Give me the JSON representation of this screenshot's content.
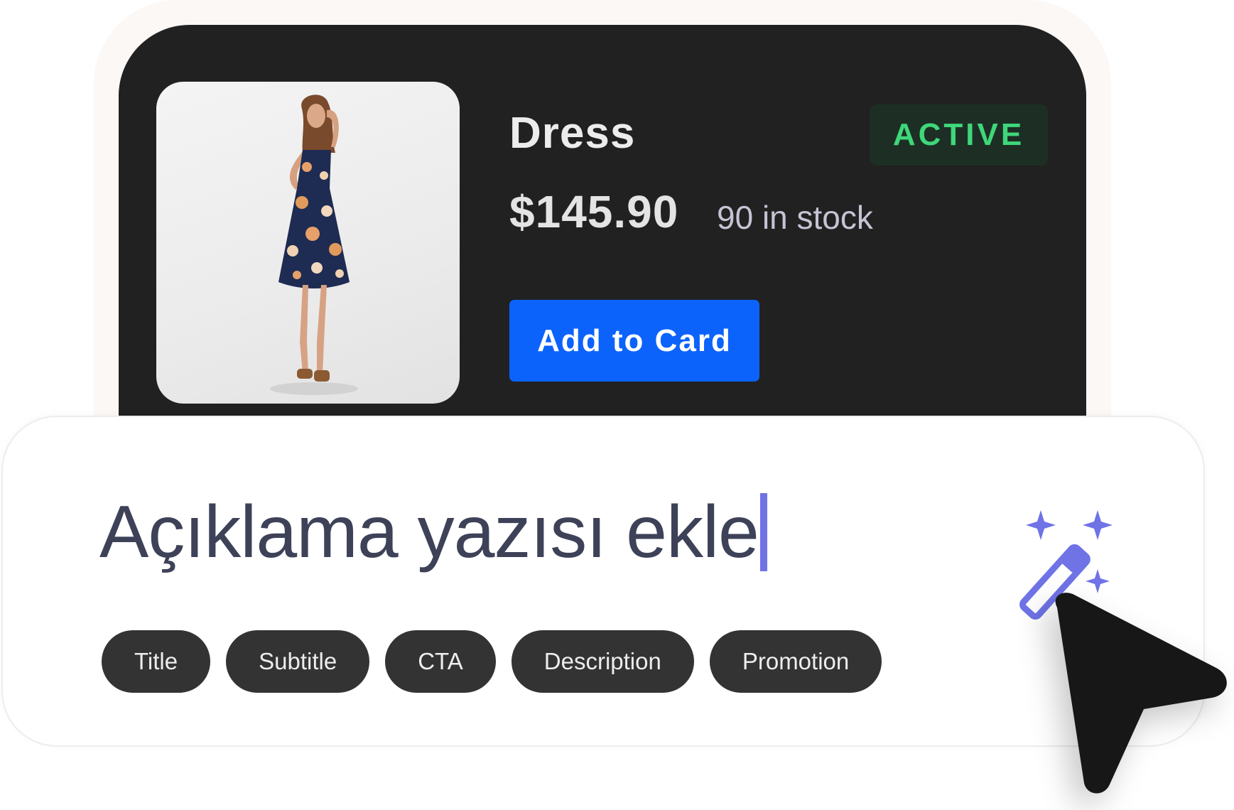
{
  "product": {
    "name": "Dress",
    "status": "ACTIVE",
    "price": "$145.90",
    "stock": "90 in stock",
    "add_button_label": "Add to Card",
    "image_icon": "dress-photo"
  },
  "editor": {
    "input_value": "Açıklama yazısı ekle",
    "chips": [
      "Title",
      "Subtitle",
      "CTA",
      "Description",
      "Promotion"
    ],
    "magic_icon": "magic-wand-icon",
    "cursor_icon": "mouse-pointer-icon"
  },
  "colors": {
    "card_background": "#212121",
    "status_green": "#3fd77a",
    "button_blue": "#0c63fb",
    "caret_purple": "#6f73e6",
    "chip_background": "#333333",
    "wand_purple": "#6f73e6"
  }
}
